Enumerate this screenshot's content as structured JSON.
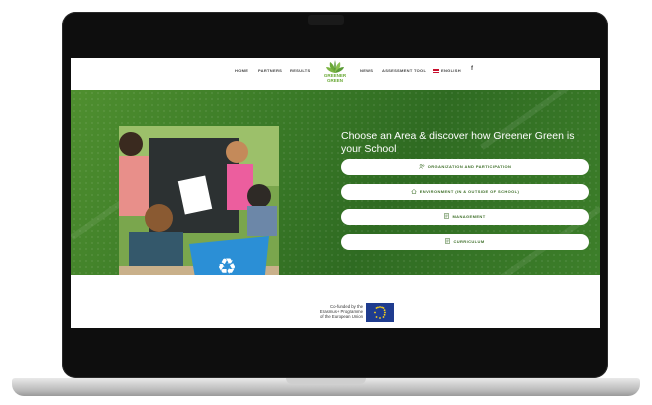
{
  "nav": {
    "home": "HOME",
    "partners": "PARTNERS",
    "results": "RESULTS",
    "news": "NEWS",
    "assessment_tool": "ASSESSMENT TOOL",
    "language": "ENGLISH",
    "facebook": "f"
  },
  "logo": {
    "line1": "GREENER",
    "line2": "GREEN"
  },
  "hero": {
    "title": "Choose an Area & discover how Greener Green is your School",
    "photo_label": "Students sorting recyclables"
  },
  "areas": [
    {
      "label": "ORGANIZATION AND PARTICIPATION",
      "icon": "people-icon"
    },
    {
      "label": "ENVIRONMENT (IN & OUTSIDE OF SCHOOL)",
      "icon": "home-icon"
    },
    {
      "label": "MANAGEMENT",
      "icon": "document-icon"
    },
    {
      "label": "CURRICULUM",
      "icon": "document-icon"
    }
  ],
  "footer": {
    "cofund_line1": "Co-funded by the",
    "cofund_line2": "Erasmus+ Programme",
    "cofund_line3": "of the European Union"
  },
  "colors": {
    "brand_green": "#3d7f2a",
    "accent_green": "#6aa936",
    "eu_blue": "#1f3c8f"
  }
}
